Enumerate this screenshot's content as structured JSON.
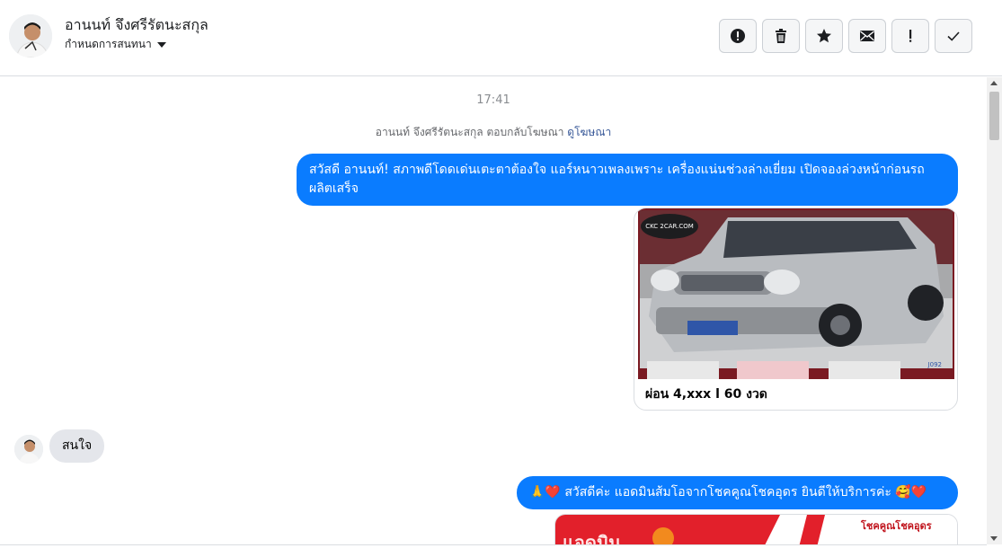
{
  "header": {
    "contact_name": "อานนท์ จึงศรีรัตนะสกุล",
    "assign_label": "กำหนดการสนทนา"
  },
  "toolbar": {
    "icons": [
      "alert-icon",
      "trash-icon",
      "star-icon",
      "mail-icon",
      "exclamation-icon",
      "check-icon"
    ]
  },
  "chat": {
    "timestamp": "17:41",
    "notice_text": "อานนท์ จึงศรีรัตนะสกุล ตอบกลับโฆษณา",
    "notice_link": "ดูโฆษณา",
    "messages": [
      {
        "direction": "outgoing",
        "text": "สวัสดี อานนท์! สภาพดีโดดเด่นเตะตาต้องใจ แอร์หนาวเพลงเพราะ เครื่องแน่นช่วงล่างเยี่ยม เปิดจองล่วงหน้าก่อนรถผลิตเสร็จ"
      },
      {
        "direction": "outgoing",
        "type": "ad-card",
        "image_watermark": "CKC 2CAR.COM",
        "image_code": "J092",
        "caption": "ผ่อน 4,xxx l 60 งวด"
      },
      {
        "direction": "incoming",
        "text": "สนใจ"
      },
      {
        "direction": "outgoing",
        "text": "🙏❤️ สวัสดีค่ะ แอดมินส้มโอจากโชคคูณโชคอุดร ยินดีให้บริการค่ะ 🥰❤️"
      },
      {
        "direction": "outgoing",
        "type": "image",
        "image_text_left": "แอดมิน",
        "image_text_right": "โชคคูณโชคอุดร"
      }
    ]
  },
  "colors": {
    "outgoing_bubble": "#0a7cff",
    "incoming_bubble": "#e4e6eb",
    "link": "#385898"
  }
}
